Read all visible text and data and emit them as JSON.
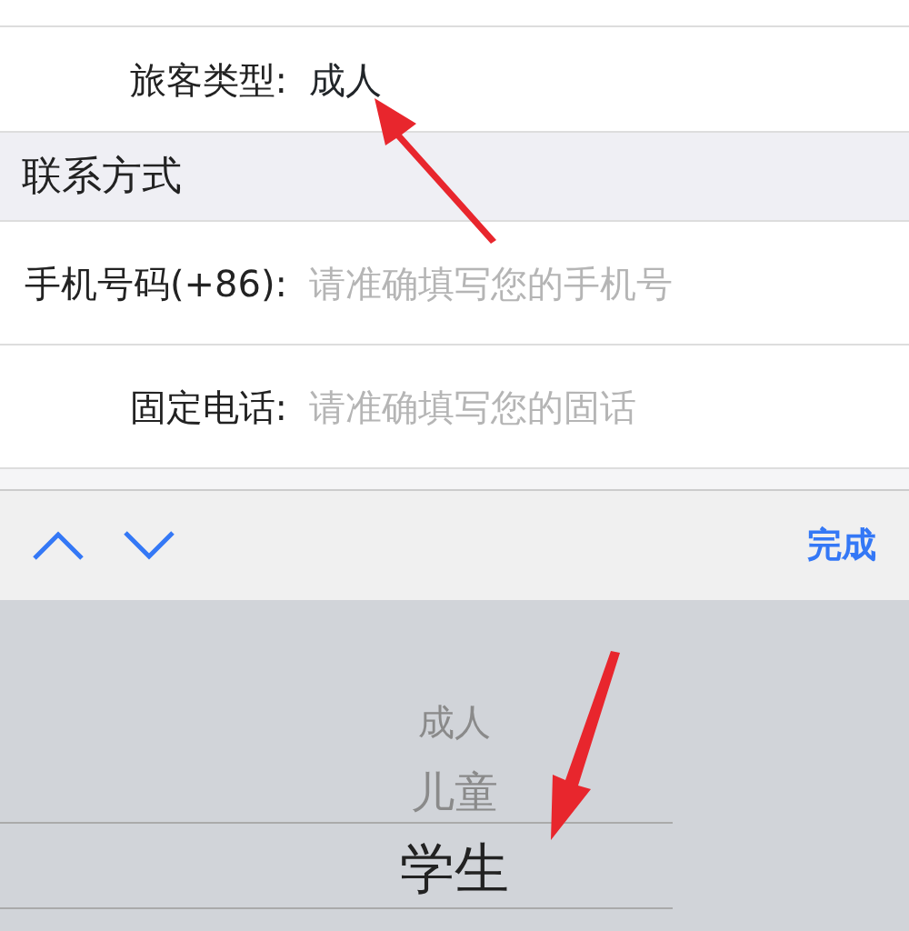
{
  "passenger_type": {
    "label": "旅客类型:",
    "value": "成人"
  },
  "section_header": "联系方式",
  "fields": [
    {
      "label": "手机号码(+86):",
      "placeholder": "请准确填写您的手机号"
    },
    {
      "label": "固定电话:",
      "placeholder": "请准确填写您的固话"
    }
  ],
  "toolbar": {
    "done": "完成"
  },
  "picker": [
    {
      "label": "成人",
      "selected": false
    },
    {
      "label": "儿童",
      "selected": false
    },
    {
      "label": "学生",
      "selected": true
    }
  ]
}
